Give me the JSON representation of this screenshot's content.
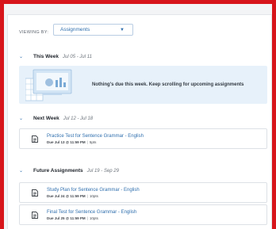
{
  "filter": {
    "label": "VIEWING BY:",
    "selected": "Assignments"
  },
  "sections": {
    "this_week": {
      "title": "This Week",
      "dates": "Jul 05 - Jul 11",
      "empty_message": "Nothing's due this week. Keep scrolling for upcoming assignments"
    },
    "next_week": {
      "title": "Next Week",
      "dates": "Jul 12 - Jul 18",
      "items": [
        {
          "title": "Practice Test for Sentence Grammar - English",
          "due": "Due Jul 13 @ 11:59 PM",
          "points": "5pts"
        }
      ]
    },
    "future": {
      "title": "Future Assignments",
      "dates": "Jul 19 - Sep 29",
      "items": [
        {
          "title": "Study Plan for Sentence Grammar - English",
          "due": "Due Jul 24 @ 11:59 PM",
          "points": "10pts"
        },
        {
          "title": "Final Test for Sentence Grammar - English",
          "due": "Due Jul 25 @ 11:59 PM",
          "points": "10pts"
        }
      ]
    }
  },
  "colors": {
    "frame": "#d7151b",
    "accent": "#2f6fae",
    "empty_bg": "#e7f1fa"
  },
  "icons": {
    "dropdown": "caret-down-icon",
    "section_toggle": "chevron-down-icon",
    "assignment": "document-icon"
  }
}
